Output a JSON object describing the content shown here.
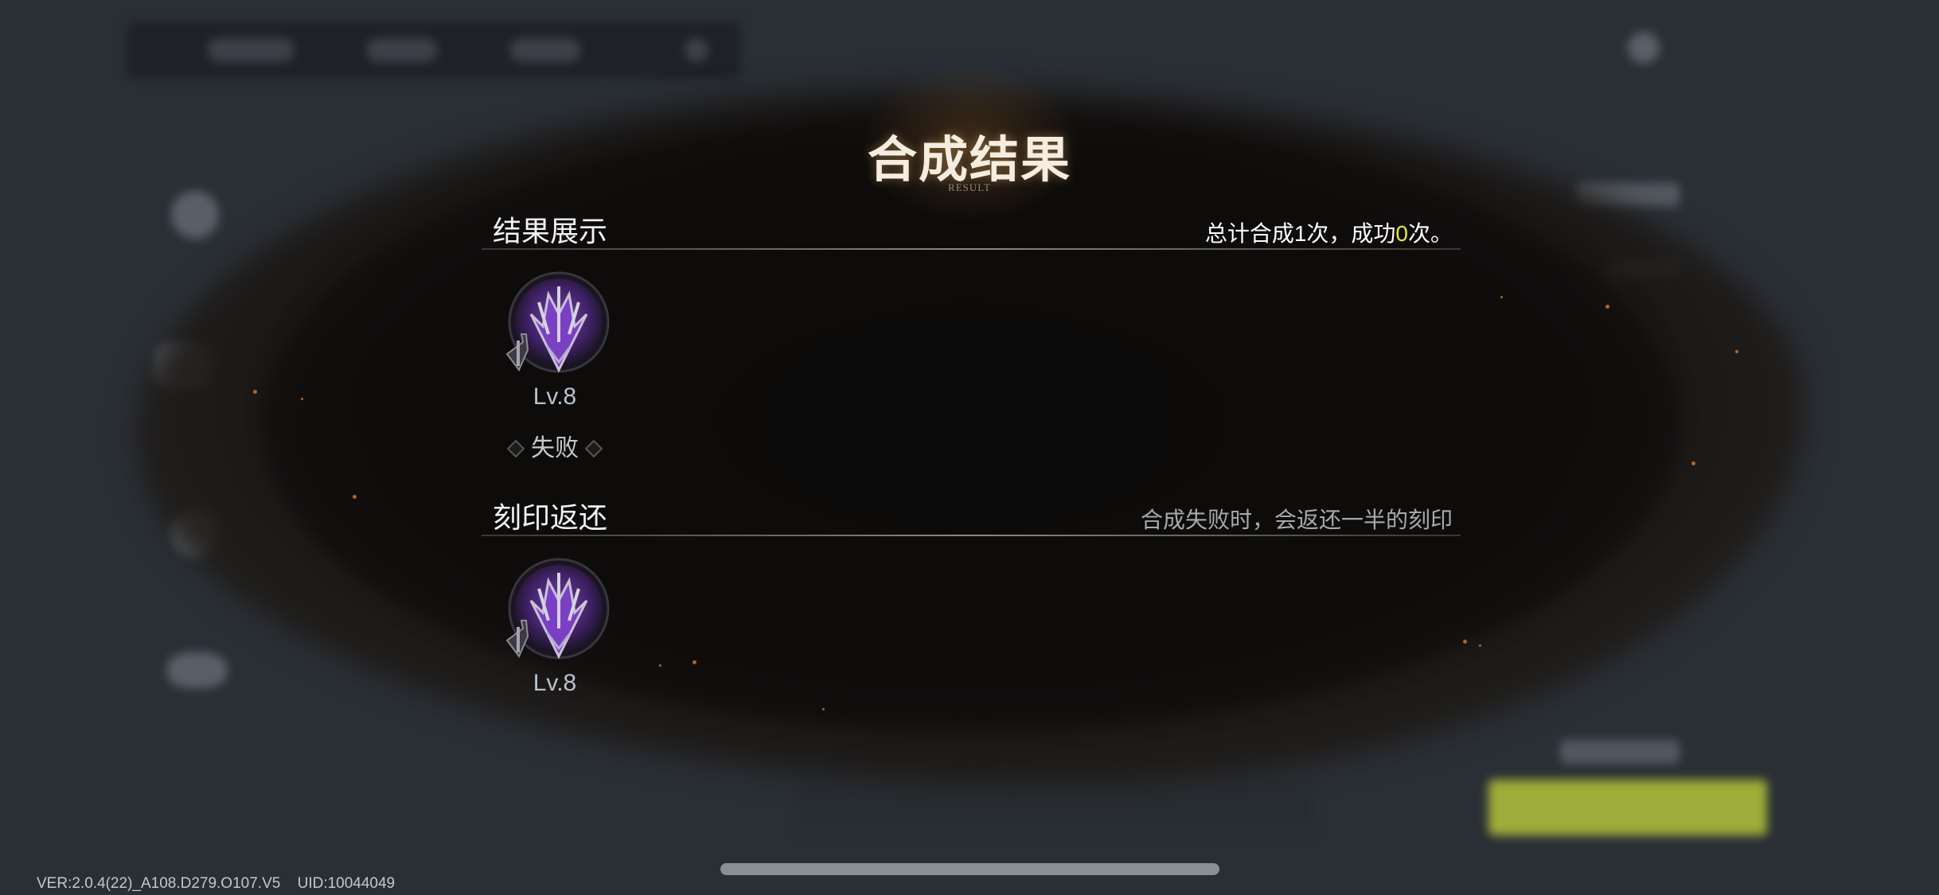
{
  "panel": {
    "title": "合成结果",
    "subtitle": "RESULT"
  },
  "result_section": {
    "heading": "结果展示",
    "summary_prefix": "总计合成1次，成功",
    "summary_count": "0",
    "summary_suffix": "次。",
    "item": {
      "icon": "purple-crest-emblem-icon",
      "level": "Lv.8",
      "status": "失败"
    }
  },
  "return_section": {
    "heading": "刻印返还",
    "note": "合成失败时，会返还一半的刻印",
    "item": {
      "icon": "purple-crest-emblem-icon",
      "level": "Lv.8"
    }
  },
  "footer": {
    "version": "VER:2.0.4(22)_A108.D279.O107.V5",
    "uid": "UID:10044049"
  },
  "colors": {
    "highlight": "#e3ec3a",
    "accent_button": "#b3c33a",
    "emblem_purple": "#7b3fc4"
  }
}
